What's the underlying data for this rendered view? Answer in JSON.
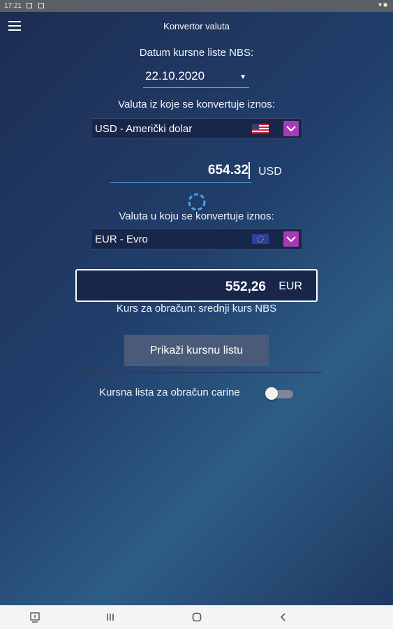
{
  "status_bar": {
    "time": "17:21"
  },
  "app": {
    "title": "Konvertor valuta"
  },
  "date_section": {
    "label": "Datum kursne liste NBS:",
    "date": "22.10.2020"
  },
  "from_section": {
    "label": "Valuta iz koje se konvertuje iznos:",
    "currency": "USD - Američki dolar",
    "flag_icon": "us-flag-icon",
    "amount": "654.32",
    "unit": "USD"
  },
  "to_section": {
    "label": "Valuta u koju se konvertuje iznos:",
    "currency": "EUR - Evro",
    "flag_icon": "eu-flag-icon",
    "amount": "552,26",
    "unit": "EUR"
  },
  "rate_note": "Kurs za obračun: srednji kurs NBS",
  "show_button": "Prikaži kursnu listu",
  "customs_toggle": {
    "label": "Kursna lista za obračun carine",
    "on": false
  },
  "colors": {
    "accent": "#a93ab5",
    "input_underline": "#52a7e0",
    "spinner": "#4aa3e6"
  }
}
